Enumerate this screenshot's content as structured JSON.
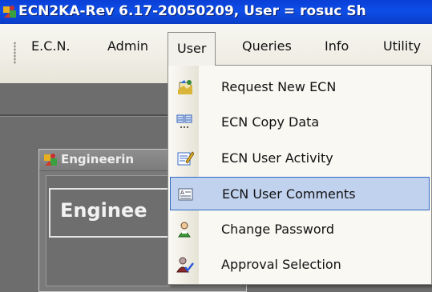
{
  "window": {
    "title": "ECN2KA-Rev 6.17-20050209, User = rosuc Sh"
  },
  "menubar": {
    "items": [
      {
        "label": "E.C.N."
      },
      {
        "label": "Admin"
      },
      {
        "label": "User",
        "open": true
      },
      {
        "label": "Queries"
      },
      {
        "label": "Info"
      },
      {
        "label": "Utility"
      }
    ]
  },
  "user_menu": {
    "items": [
      {
        "label": "Request New ECN",
        "icon": "request-ecn-icon"
      },
      {
        "label": "ECN Copy Data",
        "icon": "copy-data-icon"
      },
      {
        "label": "ECN User Activity",
        "icon": "user-activity-icon"
      },
      {
        "label": "ECN User Comments",
        "icon": "user-comments-icon",
        "highlighted": true
      },
      {
        "label": "Change Password",
        "icon": "change-password-icon"
      },
      {
        "label": "Approval Selection",
        "icon": "approval-selection-icon"
      }
    ]
  },
  "child_window": {
    "title": "Engineerin",
    "heading": "Enginee"
  },
  "colors": {
    "titlebar": "#0a3fd6",
    "menubar": "#efede4",
    "highlight": "#c1d2ee",
    "highlight_border": "#316ac5",
    "workspace": "#6d6d6d"
  }
}
